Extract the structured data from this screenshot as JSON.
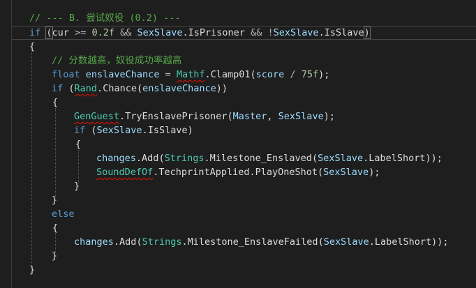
{
  "editor": {
    "lines": [
      {
        "id": "l1",
        "tokens": [
          {
            "t": "// --- B. 尝试奴役 (0.2) ---",
            "c": "cm"
          }
        ]
      },
      {
        "id": "l2",
        "tokens": [
          {
            "t": "if",
            "c": "kw"
          },
          {
            "t": " ",
            "c": "pl"
          },
          {
            "t": "(",
            "c": "pl",
            "hl": true
          },
          {
            "t": "cur",
            "c": "pl"
          },
          {
            "t": " >= ",
            "c": "op"
          },
          {
            "t": "0.2f",
            "c": "nm"
          },
          {
            "t": " && ",
            "c": "op"
          },
          {
            "t": "SexSlave",
            "c": "pr"
          },
          {
            "t": ".",
            "c": "pl"
          },
          {
            "t": "IsPrisoner",
            "c": "pl"
          },
          {
            "t": " && !",
            "c": "op"
          },
          {
            "t": "SexSlave",
            "c": "pr"
          },
          {
            "t": ".",
            "c": "pl"
          },
          {
            "t": "IsSlave",
            "c": "pl"
          },
          {
            "t": ")",
            "c": "pl",
            "hl": true
          }
        ]
      },
      {
        "id": "l3",
        "tokens": [
          {
            "t": "{",
            "c": "pl"
          }
        ]
      },
      {
        "id": "l4",
        "tokens": [
          {
            "t": "// 分数越高，奴役成功率越高",
            "c": "cm"
          }
        ]
      },
      {
        "id": "l5",
        "tokens": [
          {
            "t": "float",
            "c": "kw"
          },
          {
            "t": " ",
            "c": "pl"
          },
          {
            "t": "enslaveChance",
            "c": "pr"
          },
          {
            "t": " = ",
            "c": "op"
          },
          {
            "t": "Mathf",
            "c": "ty",
            "err": true
          },
          {
            "t": ".",
            "c": "pl"
          },
          {
            "t": "Clamp01",
            "c": "pl"
          },
          {
            "t": "(",
            "c": "pl"
          },
          {
            "t": "score",
            "c": "pr"
          },
          {
            "t": " / ",
            "c": "op"
          },
          {
            "t": "75f",
            "c": "nm"
          },
          {
            "t": ");",
            "c": "pl"
          }
        ]
      },
      {
        "id": "l6",
        "tokens": [
          {
            "t": "if",
            "c": "kw"
          },
          {
            "t": " (",
            "c": "pl"
          },
          {
            "t": "Rand",
            "c": "ty",
            "err": true
          },
          {
            "t": ".",
            "c": "pl"
          },
          {
            "t": "Chance",
            "c": "pl"
          },
          {
            "t": "(",
            "c": "pl"
          },
          {
            "t": "enslaveChance",
            "c": "pr"
          },
          {
            "t": "))",
            "c": "pl"
          }
        ]
      },
      {
        "id": "l7",
        "tokens": [
          {
            "t": "{",
            "c": "pl"
          }
        ]
      },
      {
        "id": "l8",
        "tokens": [
          {
            "t": "GenGuest",
            "c": "ty",
            "err": true
          },
          {
            "t": ".",
            "c": "pl"
          },
          {
            "t": "TryEnslavePrisoner",
            "c": "pl"
          },
          {
            "t": "(",
            "c": "pl"
          },
          {
            "t": "Master",
            "c": "pr"
          },
          {
            "t": ", ",
            "c": "pl"
          },
          {
            "t": "SexSlave",
            "c": "pr"
          },
          {
            "t": ");",
            "c": "pl"
          }
        ]
      },
      {
        "id": "l9",
        "tokens": [
          {
            "t": "if",
            "c": "kw"
          },
          {
            "t": " (",
            "c": "pl"
          },
          {
            "t": "SexSlave",
            "c": "pr"
          },
          {
            "t": ".",
            "c": "pl"
          },
          {
            "t": "IsSlave",
            "c": "pl"
          },
          {
            "t": ")",
            "c": "pl"
          }
        ]
      },
      {
        "id": "l10",
        "tokens": [
          {
            "t": "{",
            "c": "pl"
          }
        ]
      },
      {
        "id": "l11",
        "tokens": [
          {
            "t": "changes",
            "c": "pr"
          },
          {
            "t": ".",
            "c": "pl"
          },
          {
            "t": "Add",
            "c": "pl"
          },
          {
            "t": "(",
            "c": "pl"
          },
          {
            "t": "Strings",
            "c": "ty"
          },
          {
            "t": ".",
            "c": "pl"
          },
          {
            "t": "Milestone_Enslaved",
            "c": "pl"
          },
          {
            "t": "(",
            "c": "pl"
          },
          {
            "t": "SexSlave",
            "c": "pr"
          },
          {
            "t": ".",
            "c": "pl"
          },
          {
            "t": "LabelShort",
            "c": "pl"
          },
          {
            "t": "));",
            "c": "pl"
          }
        ]
      },
      {
        "id": "l12",
        "tokens": [
          {
            "t": "SoundDefOf",
            "c": "ty",
            "err": true
          },
          {
            "t": ".",
            "c": "pl"
          },
          {
            "t": "TechprintApplied",
            "c": "pl"
          },
          {
            "t": ".",
            "c": "pl"
          },
          {
            "t": "PlayOneShot",
            "c": "pl"
          },
          {
            "t": "(",
            "c": "pl"
          },
          {
            "t": "SexSlave",
            "c": "pr"
          },
          {
            "t": ");",
            "c": "pl"
          }
        ]
      },
      {
        "id": "l13",
        "tokens": [
          {
            "t": "}",
            "c": "pl"
          }
        ]
      },
      {
        "id": "l14",
        "tokens": [
          {
            "t": "}",
            "c": "pl"
          }
        ]
      },
      {
        "id": "l15",
        "tokens": [
          {
            "t": "else",
            "c": "kw"
          }
        ]
      },
      {
        "id": "l16",
        "tokens": [
          {
            "t": "{",
            "c": "pl"
          }
        ]
      },
      {
        "id": "l17",
        "tokens": [
          {
            "t": "changes",
            "c": "pr"
          },
          {
            "t": ".",
            "c": "pl"
          },
          {
            "t": "Add",
            "c": "pl"
          },
          {
            "t": "(",
            "c": "pl"
          },
          {
            "t": "Strings",
            "c": "ty"
          },
          {
            "t": ".",
            "c": "pl"
          },
          {
            "t": "Milestone_EnslaveFailed",
            "c": "pl"
          },
          {
            "t": "(",
            "c": "pl"
          },
          {
            "t": "SexSlave",
            "c": "pr"
          },
          {
            "t": ".",
            "c": "pl"
          },
          {
            "t": "LabelShort",
            "c": "pl"
          },
          {
            "t": "));",
            "c": "pl"
          }
        ]
      },
      {
        "id": "l18",
        "tokens": [
          {
            "t": "}",
            "c": "pl"
          }
        ]
      },
      {
        "id": "l19",
        "tokens": [
          {
            "t": "}",
            "c": "pl"
          }
        ]
      }
    ]
  }
}
